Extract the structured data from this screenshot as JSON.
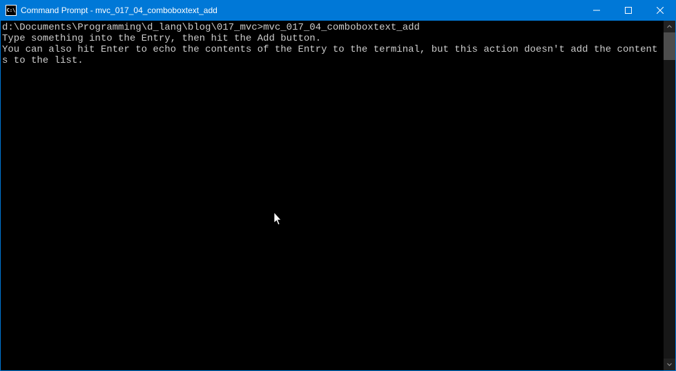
{
  "titlebar": {
    "icon_label": "C:\\",
    "title": "Command Prompt - mvc_017_04_comboboxtext_add"
  },
  "console": {
    "prompt_path": "d:\\Documents\\Programming\\d_lang\\blog\\017_mvc>",
    "command": "mvc_017_04_comboboxtext_add",
    "line1": "Type something into the Entry, then hit the Add button.",
    "line2": "You can also hit Enter to echo the contents of the Entry to the terminal, but this action doesn't add the contents to the list."
  }
}
